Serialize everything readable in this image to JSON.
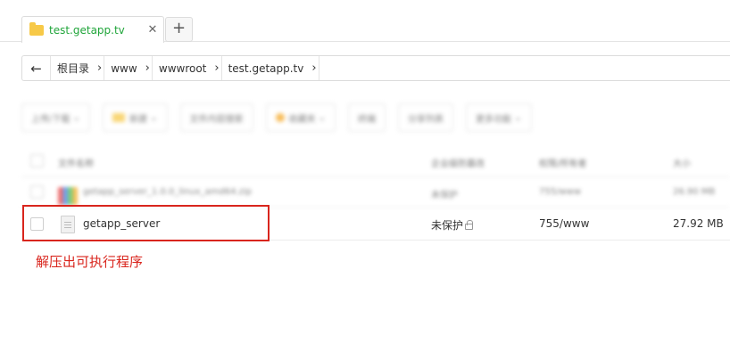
{
  "tab": {
    "title": "test.getapp.tv",
    "close": "✕",
    "new": "+"
  },
  "breadcrumb": {
    "back": "←",
    "items": [
      "根目录",
      "www",
      "wwwroot",
      "test.getapp.tv"
    ],
    "sep": "›"
  },
  "toolbar": {
    "buttons": [
      "上传/下载",
      "新建",
      "文件内容搜索",
      "收藏夹",
      "终端",
      "分享列表",
      "更多功能"
    ]
  },
  "table": {
    "headers": {
      "name": "文件名称",
      "protect": "企业级防篡改",
      "perm": "权限/所有者",
      "size": "大小"
    },
    "rows": [
      {
        "name": "getapp_server_1.0.0_linux_amd64.zip",
        "protect": "未保护",
        "perm": "755/www",
        "size": "26.90 MB"
      },
      {
        "name": "getapp_server",
        "protect": "未保护",
        "perm": "755/www",
        "size": "27.92 MB"
      }
    ]
  },
  "annotation": "解压出可执行程序",
  "colors": {
    "accent": "#20a53a",
    "annotation": "#d9251d",
    "folder": "#f7c948"
  }
}
